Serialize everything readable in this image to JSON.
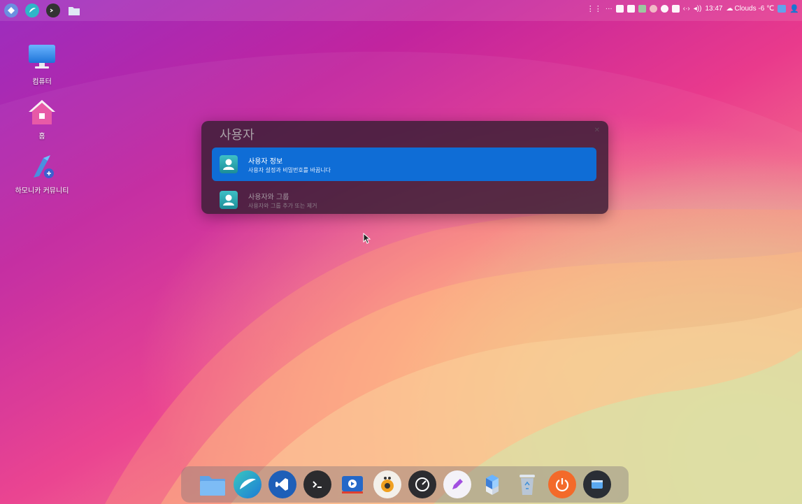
{
  "topbar": {
    "launchers": [
      "app-logo-icon",
      "browser-icon",
      "terminal-icon",
      "folder-icon"
    ],
    "tray_icons": [
      "grid-icon",
      "more-icon",
      "clipboard-icon",
      "clipboard2-icon",
      "monitor-icon",
      "shield-icon",
      "bluetooth-icon",
      "ime-icon",
      "network-icon",
      "volume-icon"
    ],
    "clock": "13:47",
    "weather": "Clouds -6 ℃"
  },
  "desktop": {
    "icons": [
      {
        "label": "컴퓨터",
        "icon": "computer-icon"
      },
      {
        "label": "홈",
        "icon": "home-folder-icon"
      },
      {
        "label": "하모니카 커뮤니티",
        "icon": "community-link-icon"
      }
    ]
  },
  "popup": {
    "title": "사용자",
    "items": [
      {
        "name": "사용자 정보",
        "desc": "사용자 설정과 비밀번호를 바꿉니다",
        "selected": true
      },
      {
        "name": "사용자와 그룹",
        "desc": "사용자와 그룹 추가 또는 제거",
        "selected": false
      }
    ]
  },
  "dock": {
    "apps": [
      "files-icon",
      "whale-browser-icon",
      "vscode-icon",
      "terminal-icon",
      "screen-recorder-icon",
      "music-player-icon",
      "speedometer-icon",
      "text-editor-icon",
      "package-manager-icon",
      "trash-icon",
      "power-icon",
      "window-icon"
    ]
  },
  "colors": {
    "accent": "#0f6dd6",
    "popup_bg": "#3c1e37"
  }
}
